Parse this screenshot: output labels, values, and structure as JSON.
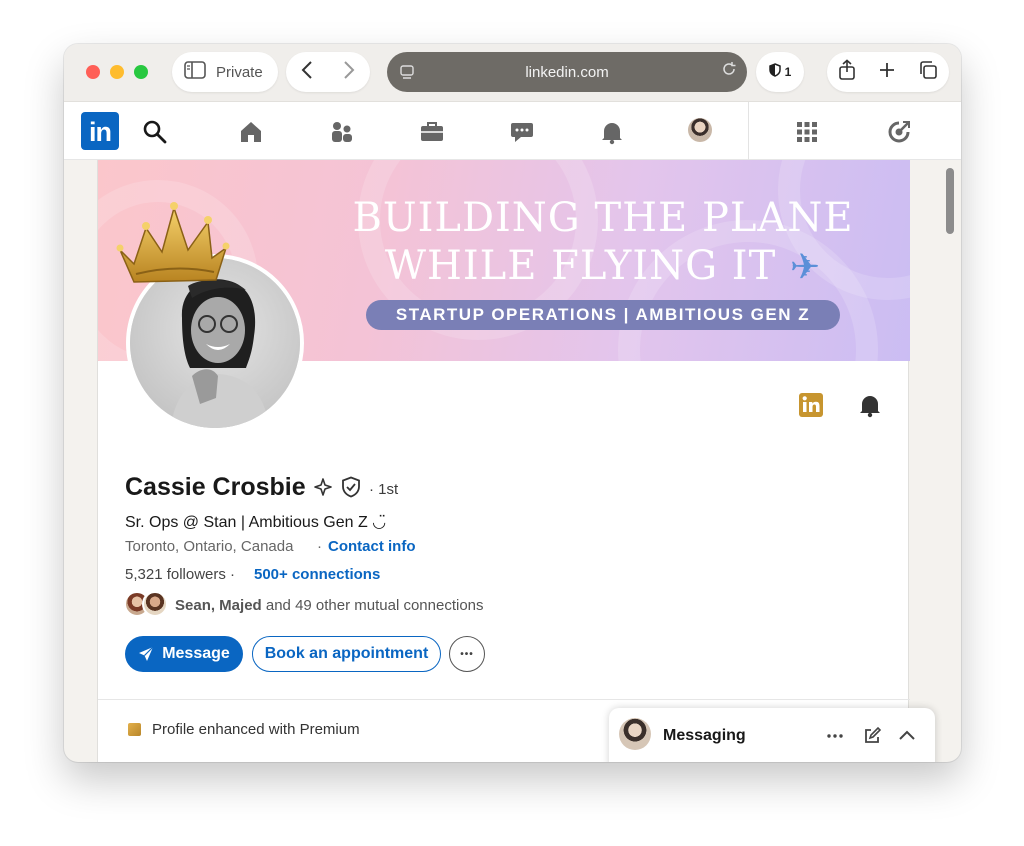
{
  "browser": {
    "private_label": "Private",
    "url": "linkedin.com",
    "shield_count": "1"
  },
  "banner": {
    "line1": "BUILDING THE PLANE",
    "line2": "WHILE FLYING IT",
    "plane_emoji": "✈",
    "tagline": "STARTUP OPERATIONS | AMBITIOUS GEN Z"
  },
  "profile": {
    "name": "Cassie Crosbie",
    "degree": "· 1st",
    "headline": "Sr. Ops @ Stan | Ambitious Gen Z ◡̈",
    "location": "Toronto, Ontario, Canada",
    "contact_sep": "·",
    "contact_info": "Contact info",
    "followers": "5,321 followers ·",
    "connections": "500+ connections",
    "mutual_names": "Sean, Majed",
    "mutual_rest": " and 49 other mutual connections"
  },
  "actions": {
    "message": "Message",
    "book": "Book an appointment",
    "more": "•••"
  },
  "premium": {
    "text": "Profile enhanced with Premium"
  },
  "messaging": {
    "title": "Messaging"
  },
  "colors": {
    "linkedin_blue": "#0a66c2",
    "premium_gold": "#c7952f"
  }
}
